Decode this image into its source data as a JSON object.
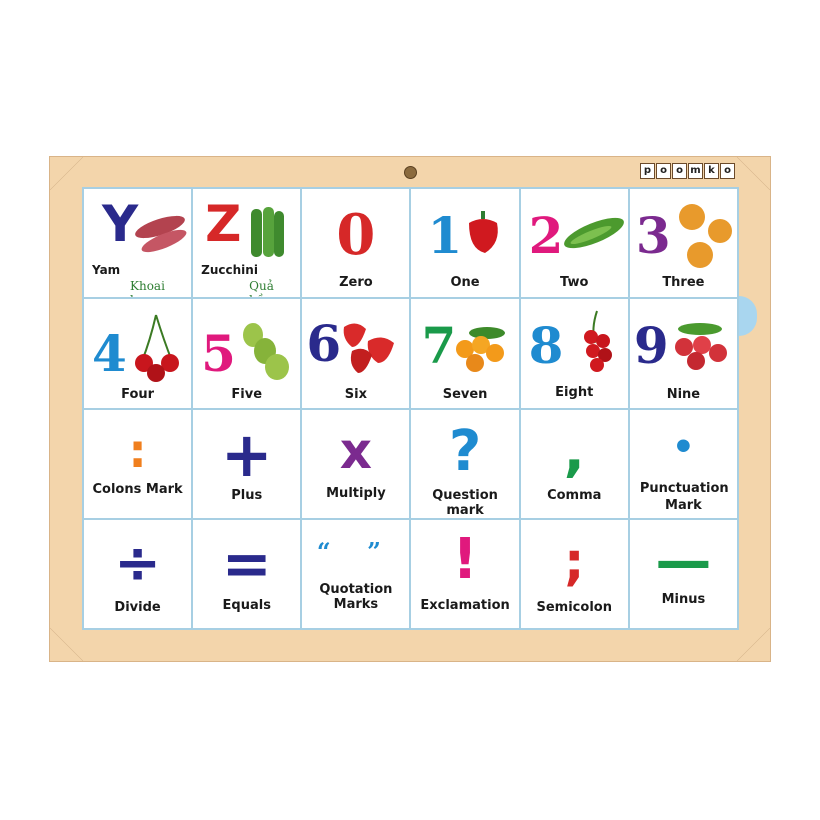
{
  "brand": [
    "p",
    "o",
    "o",
    "m",
    "k",
    "o"
  ],
  "cards": [
    {
      "glyph": "Y",
      "label": "Yam",
      "sub": "Khoai lang",
      "icon": "sweet-potato-icon",
      "color": "#2a2a8c"
    },
    {
      "glyph": "Z",
      "label": "Zucchini",
      "sub": "Quả bầu",
      "icon": "zucchini-icon",
      "color": "#d62828"
    },
    {
      "glyph": "0",
      "label": "Zero",
      "color": "#d62828"
    },
    {
      "glyph": "1",
      "label": "One",
      "icon": "red-pepper-icon",
      "color": "#1f8bd0"
    },
    {
      "glyph": "2",
      "label": "Two",
      "icon": "cucumber-icon",
      "color": "#e0197d"
    },
    {
      "glyph": "3",
      "label": "Three",
      "icon": "onion-icon",
      "color": "#7b2a8f"
    },
    {
      "glyph": "4",
      "label": "Four",
      "icon": "cherry-icon",
      "color": "#1f8bd0"
    },
    {
      "glyph": "5",
      "label": "Five",
      "icon": "pear-icon",
      "color": "#e0197d"
    },
    {
      "glyph": "6",
      "label": "Six",
      "icon": "strawberry-icon",
      "color": "#2a2a8c"
    },
    {
      "glyph": "7",
      "label": "Seven",
      "icon": "orange-fruit-icon",
      "color": "#1a9a4a"
    },
    {
      "glyph": "8",
      "label": "Eight",
      "icon": "berries-icon",
      "color": "#1f8bd0"
    },
    {
      "glyph": "9",
      "label": "Nine",
      "icon": "radish-icon",
      "color": "#2a2a8c"
    },
    {
      "glyph": ":",
      "label": "Colons Mark",
      "color": "#f07f1e"
    },
    {
      "glyph": "+",
      "label": "Plus",
      "color": "#2a2a8c"
    },
    {
      "glyph": "x",
      "label": "Multiply",
      "color": "#7b2a8f"
    },
    {
      "glyph": "?",
      "label": "Question mark",
      "color": "#1f8bd0"
    },
    {
      "glyph": ",",
      "label": "Comma",
      "color": "#1a9a4a"
    },
    {
      "glyph": "•",
      "label": "Punctuation Mark",
      "color": "#1f8bd0"
    },
    {
      "glyph": "÷",
      "label": "Divide",
      "color": "#2a2a8c"
    },
    {
      "glyph": "=",
      "label": "Equals",
      "color": "#2a2a8c"
    },
    {
      "glyph": "“ ”",
      "label": "Quotation Marks",
      "color": "#1f8bd0"
    },
    {
      "glyph": "!",
      "label": "Exclamation",
      "color": "#e0197d"
    },
    {
      "glyph": ";",
      "label": "Semicolon",
      "color": "#d62828"
    },
    {
      "glyph": "—",
      "label": "Minus",
      "color": "#1a9a4a"
    }
  ]
}
